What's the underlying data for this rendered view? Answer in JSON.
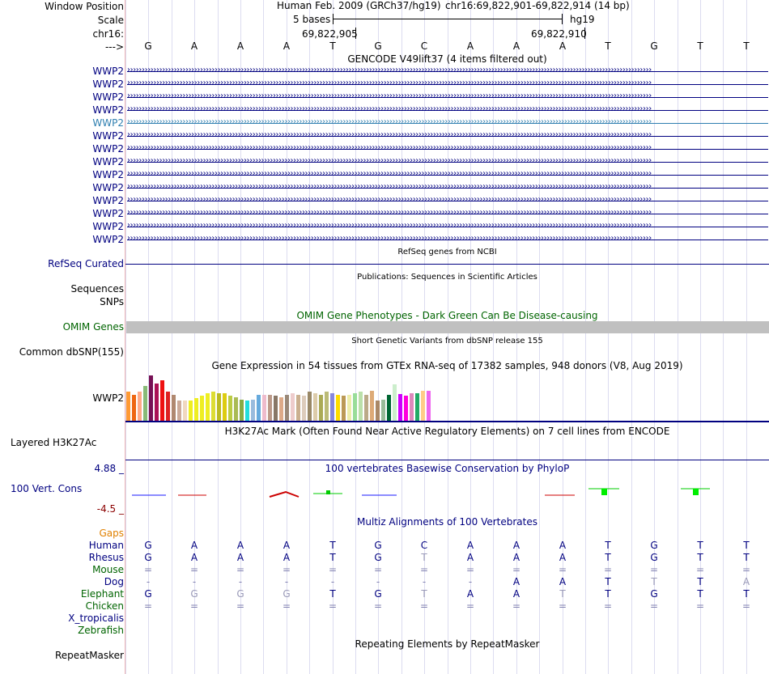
{
  "header": {
    "window_position_label": "Window Position",
    "scale_label": "Scale",
    "chrom_label": "chr16:",
    "strand_label": "--->",
    "assembly": "Human Feb. 2009 (GRCh37/hg19)",
    "position": "chr16:69,822,901-69,822,914 (14 bp)",
    "scale_text": "5 bases",
    "scale_db": "hg19",
    "ruler_left": "69,822,905",
    "ruler_right": "69,822,910"
  },
  "sequence": [
    "G",
    "A",
    "A",
    "A",
    "T",
    "G",
    "C",
    "A",
    "A",
    "A",
    "T",
    "G",
    "T",
    "T"
  ],
  "gencode": {
    "title": "GENCODE V49lift37 (4 items filtered out)",
    "items": [
      "WWP2",
      "WWP2",
      "WWP2",
      "WWP2",
      "WWP2",
      "WWP2",
      "WWP2",
      "WWP2",
      "WWP2",
      "WWP2",
      "WWP2",
      "WWP2",
      "WWP2",
      "WWP2"
    ],
    "highlight_index": 4,
    "colors": {
      "navy": "#000080",
      "highlight": "#2f7fb0"
    }
  },
  "refseq": {
    "title": "RefSeq genes from NCBI",
    "label": "RefSeq Curated"
  },
  "publications": {
    "title": "Publications: Sequences in Scientific Articles",
    "label_sequences": "Sequences",
    "label_snps": "SNPs"
  },
  "omim": {
    "title": "OMIM Gene Phenotypes - Dark Green Can Be Disease-causing",
    "label": "OMIM Genes",
    "color": "#006400",
    "bar_color": "#c0c0c0"
  },
  "dbsnp": {
    "title": "Short Genetic Variants from dbSNP release 155",
    "label": "Common dbSNP(155)"
  },
  "gtex": {
    "title": "Gene Expression in 54 tissues from GTEx RNA-seq of 17382 samples, 948 donors (V8, Aug 2019)",
    "label": "WWP2",
    "levels": [
      0.58,
      0.52,
      0.58,
      0.7,
      0.9,
      0.74,
      0.8,
      0.58,
      0.52,
      0.4,
      0.4,
      0.4,
      0.45,
      0.5,
      0.55,
      0.58,
      0.55,
      0.55,
      0.5,
      0.46,
      0.42,
      0.4,
      0.42,
      0.52,
      0.52,
      0.52,
      0.5,
      0.46,
      0.52,
      0.55,
      0.52,
      0.5,
      0.58,
      0.55,
      0.52,
      0.58,
      0.55,
      0.52,
      0.5,
      0.52,
      0.55,
      0.58,
      0.52,
      0.6,
      0.4,
      0.42,
      0.52,
      0.72,
      0.54,
      0.5,
      0.55,
      0.55,
      0.6,
      0.6,
      0.56
    ],
    "colors": [
      "#ff9933",
      "#ee6611",
      "#ffaa88",
      "#88bb77",
      "#771155",
      "#aa1155",
      "#ee1111",
      "#dd2222",
      "#b08870",
      "#ccaa99",
      "#f0d8c0",
      "#eeee22",
      "#eeee22",
      "#eeee22",
      "#eeee22",
      "#dddd33",
      "#bbbb22",
      "#ddcc11",
      "#bbcc44",
      "#aabb55",
      "#88aa44",
      "#22dddd",
      "#99bbdd",
      "#66aadd",
      "#eebbcc",
      "#bb9988",
      "#887766",
      "#ddaa88",
      "#998877",
      "#eecccc",
      "#cbb090",
      "#ddccbb",
      "#998866",
      "#ddccaa",
      "#aaaa55",
      "#bbbb77",
      "#8888dd",
      "#ffdd00",
      "#bb9955",
      "#eeeeaa",
      "#99dd99",
      "#bbe0aa",
      "#bbaa88",
      "#ddaa77",
      "#aa8866",
      "#99bb99",
      "#006633",
      "#cceecc",
      "#cc00ff",
      "#ff00dd",
      "#dd88bb",
      "#22aa66",
      "#ffcc88",
      "#ee66ee"
    ]
  },
  "h3k27ac": {
    "title": "H3K27Ac Mark (Often Found Near Active Regulatory Elements) on 7 cell lines from ENCODE",
    "label": "Layered H3K27Ac"
  },
  "phylop": {
    "title": "100 vertebrates Basewise Conservation by PhyloP",
    "label": "100 Vert. Cons",
    "max": "4.88 _",
    "min": "-4.5 _"
  },
  "multiz": {
    "title": "Multiz Alignments of 100 Vertebrates",
    "gaps_label": "Gaps",
    "species": [
      {
        "name": "Human",
        "color": "#000080",
        "bases": [
          "G",
          "A",
          "A",
          "A",
          "T",
          "G",
          "C",
          "A",
          "A",
          "A",
          "T",
          "G",
          "T",
          "T"
        ]
      },
      {
        "name": "Rhesus",
        "color": "#000080",
        "bases": [
          "G",
          "A",
          "A",
          "A",
          "T",
          "G",
          "T",
          "A",
          "A",
          "A",
          "T",
          "G",
          "T",
          "T"
        ]
      },
      {
        "name": "Mouse",
        "color": "#006400",
        "bases": [
          "=",
          "=",
          "=",
          "=",
          "=",
          "=",
          "=",
          "=",
          "=",
          "=",
          "=",
          "=",
          "=",
          "="
        ]
      },
      {
        "name": "Dog",
        "color": "#000080",
        "bases": [
          "-",
          "-",
          "-",
          "-",
          "-",
          "-",
          "-",
          "-",
          "A",
          "A",
          "T",
          "T",
          "T",
          "A"
        ]
      },
      {
        "name": "Elephant",
        "color": "#006400",
        "bases": [
          "G",
          "G",
          "G",
          "G",
          "T",
          "G",
          "T",
          "A",
          "A",
          "T",
          "T",
          "G",
          "T",
          "T"
        ]
      },
      {
        "name": "Chicken",
        "color": "#006400",
        "bases": [
          "=",
          "=",
          "=",
          "=",
          "=",
          "=",
          "=",
          "=",
          "=",
          "=",
          "=",
          "=",
          "=",
          "="
        ]
      },
      {
        "name": "X_tropicalis",
        "color": "#000080",
        "bases": []
      },
      {
        "name": "Zebrafish",
        "color": "#006400",
        "bases": []
      }
    ]
  },
  "repeatmasker": {
    "title": "Repeating Elements by RepeatMasker",
    "label": "RepeatMasker"
  }
}
